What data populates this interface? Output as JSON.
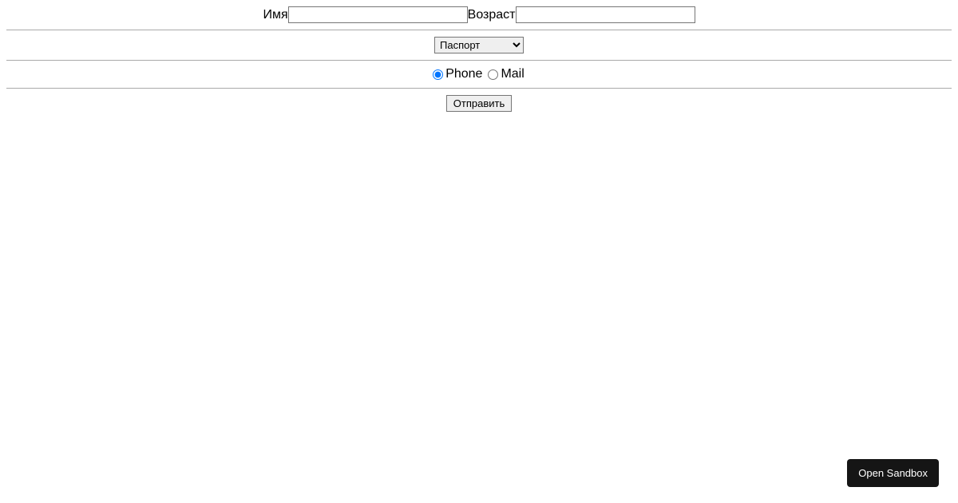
{
  "form": {
    "name_label": "Имя",
    "age_label": "Возраст",
    "select": {
      "selected": "Паспорт"
    },
    "radios": {
      "phone_label": "Phone",
      "mail_label": "Mail",
      "selected": "phone"
    },
    "submit_label": "Отправить"
  },
  "sandbox_button": "Open Sandbox"
}
